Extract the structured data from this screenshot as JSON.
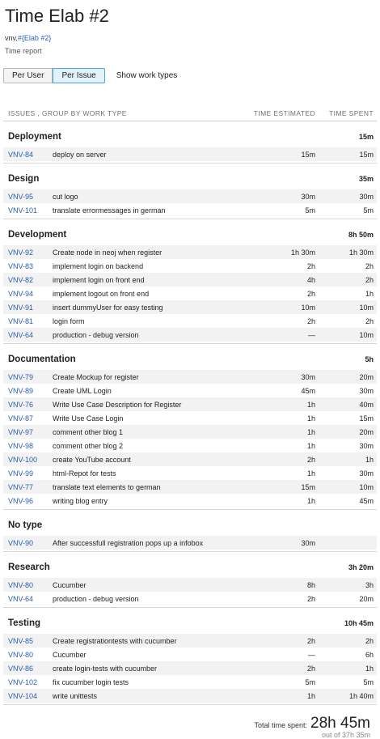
{
  "header": {
    "title": "Time Elab #2",
    "crumb_project": "vnv",
    "crumb_sep": ",",
    "crumb_link": "#{Elab #2}",
    "subtitle": "Time report"
  },
  "toolbar": {
    "per_user": "Per User",
    "per_issue": "Per Issue",
    "show_work_types": "Show work types"
  },
  "table": {
    "col_issues": "ISSUES , GROUP BY WORK TYPE",
    "col_estimated": "TIME ESTIMATED",
    "col_spent": "TIME SPENT"
  },
  "groups": [
    {
      "name": "Deployment",
      "total": "15m",
      "rows": [
        {
          "key": "VNV-84",
          "summary": "deploy on server",
          "est": "15m",
          "spent": "15m"
        }
      ]
    },
    {
      "name": "Design",
      "total": "35m",
      "rows": [
        {
          "key": "VNV-95",
          "summary": "cut logo",
          "est": "30m",
          "spent": "30m"
        },
        {
          "key": "VNV-101",
          "summary": "translate errormessages in german",
          "est": "5m",
          "spent": "5m"
        }
      ]
    },
    {
      "name": "Development",
      "total": "8h 50m",
      "rows": [
        {
          "key": "VNV-92",
          "summary": "Create node in neoj when register",
          "est": "1h 30m",
          "spent": "1h 30m"
        },
        {
          "key": "VNV-83",
          "summary": "implement login on backend",
          "est": "2h",
          "spent": "2h"
        },
        {
          "key": "VNV-82",
          "summary": "implement login on front end",
          "est": "4h",
          "spent": "2h"
        },
        {
          "key": "VNV-94",
          "summary": "implement logout on front end",
          "est": "2h",
          "spent": "1h"
        },
        {
          "key": "VNV-91",
          "summary": "insert dummyUser for easy testing",
          "est": "10m",
          "spent": "10m"
        },
        {
          "key": "VNV-81",
          "summary": "login form",
          "est": "2h",
          "spent": "2h"
        },
        {
          "key": "VNV-64",
          "summary": "production - debug version",
          "est": "—",
          "spent": "10m"
        }
      ]
    },
    {
      "name": "Documentation",
      "total": "5h",
      "rows": [
        {
          "key": "VNV-79",
          "summary": "Create Mockup for register",
          "est": "30m",
          "spent": "20m"
        },
        {
          "key": "VNV-89",
          "summary": "Create UML Login",
          "est": "45m",
          "spent": "30m"
        },
        {
          "key": "VNV-76",
          "summary": "Write Use Case Description for Register",
          "est": "1h",
          "spent": "40m"
        },
        {
          "key": "VNV-87",
          "summary": "Write Use Case Login",
          "est": "1h",
          "spent": "15m"
        },
        {
          "key": "VNV-97",
          "summary": "comment other blog 1",
          "est": "1h",
          "spent": "20m"
        },
        {
          "key": "VNV-98",
          "summary": "comment other blog 2",
          "est": "1h",
          "spent": "30m"
        },
        {
          "key": "VNV-100",
          "summary": "create YouTube account",
          "est": "2h",
          "spent": "1h"
        },
        {
          "key": "VNV-99",
          "summary": "html-Repot for tests",
          "est": "1h",
          "spent": "30m"
        },
        {
          "key": "VNV-77",
          "summary": "translate text elements to german",
          "est": "15m",
          "spent": "10m"
        },
        {
          "key": "VNV-96",
          "summary": "writing blog entry",
          "est": "1h",
          "spent": "45m"
        }
      ]
    },
    {
      "name": "No type",
      "total": "",
      "rows": [
        {
          "key": "VNV-90",
          "summary": "After successfull registration pops up a infobox",
          "est": "30m",
          "spent": ""
        }
      ]
    },
    {
      "name": "Research",
      "total": "3h 20m",
      "rows": [
        {
          "key": "VNV-80",
          "summary": "Cucumber",
          "est": "8h",
          "spent": "3h"
        },
        {
          "key": "VNV-64",
          "summary": "production - debug version",
          "est": "2h",
          "spent": "20m"
        }
      ]
    },
    {
      "name": "Testing",
      "total": "10h 45m",
      "rows": [
        {
          "key": "VNV-85",
          "summary": "Create registrationtests with cucumber",
          "est": "2h",
          "spent": "2h"
        },
        {
          "key": "VNV-80",
          "summary": "Cucumber",
          "est": "—",
          "spent": "6h"
        },
        {
          "key": "VNV-86",
          "summary": "create login-tests with cucumber",
          "est": "2h",
          "spent": "1h"
        },
        {
          "key": "VNV-102",
          "summary": "fix cucumber login tests",
          "est": "5m",
          "spent": "5m"
        },
        {
          "key": "VNV-104",
          "summary": "write unittests",
          "est": "1h",
          "spent": "1h 40m"
        }
      ]
    }
  ],
  "summary": {
    "total_label": "Total time spent:",
    "total_value": "28h 45m",
    "out_of": "out of 37h 35m"
  }
}
